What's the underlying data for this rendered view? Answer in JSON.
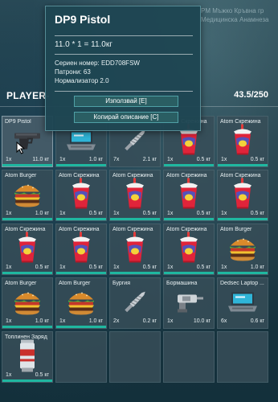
{
  "background": {
    "lines": [
      "PM   Мъжко   Кръвна гр",
      "",
      "",
      "",
      "Медицинска Анамнеза"
    ]
  },
  "inventory": {
    "title": "PLAYER-",
    "weight": "43.5/250"
  },
  "tooltip": {
    "title": "DP9 Pistol",
    "formula": "11.0 * 1 = 11.0кг",
    "props": [
      "Сериен номер: EDD708FSW",
      "Патрони: 63",
      "Нормализатор 2.0"
    ],
    "use_button": "Използвай [E]",
    "copy_button": "Копирай описание [C]"
  },
  "items": [
    {
      "name": "DP9 Pistol",
      "qty": "1x",
      "weight": "11.0 кг",
      "icon": "pistol-icon",
      "bar": true,
      "selected": true
    },
    {
      "name": "",
      "qty": "1x",
      "weight": "1.0 кг",
      "icon": "laptop-icon",
      "bar": true
    },
    {
      "name": "",
      "qty": "7x",
      "weight": "2.1 кг",
      "icon": "drill-bit-icon",
      "bar": false
    },
    {
      "name": "Atom Скрежина",
      "qty": "1x",
      "weight": "0.5 кг",
      "icon": "slush-cup-icon",
      "bar": true
    },
    {
      "name": "Atom Скрежина",
      "qty": "1x",
      "weight": "0.5 кг",
      "icon": "slush-cup-icon",
      "bar": true
    },
    {
      "name": "Atom Burger",
      "qty": "1x",
      "weight": "1.0 кг",
      "icon": "burger-icon",
      "bar": true
    },
    {
      "name": "Atom Скрежина",
      "qty": "1x",
      "weight": "0.5 кг",
      "icon": "slush-cup-icon",
      "bar": true
    },
    {
      "name": "Atom Скрежина",
      "qty": "1x",
      "weight": "0.5 кг",
      "icon": "slush-cup-icon",
      "bar": true
    },
    {
      "name": "Atom Скрежина",
      "qty": "1x",
      "weight": "0.5 кг",
      "icon": "slush-cup-icon",
      "bar": true
    },
    {
      "name": "Atom Скрежина",
      "qty": "1x",
      "weight": "0.5 кг",
      "icon": "slush-cup-icon",
      "bar": true
    },
    {
      "name": "Atom Скрежина",
      "qty": "1x",
      "weight": "0.5 кг",
      "icon": "slush-cup-icon",
      "bar": true
    },
    {
      "name": "Atom Скрежина",
      "qty": "1x",
      "weight": "0.5 кг",
      "icon": "slush-cup-icon",
      "bar": true
    },
    {
      "name": "Atom Скрежина",
      "qty": "1x",
      "weight": "0.5 кг",
      "icon": "slush-cup-icon",
      "bar": true
    },
    {
      "name": "Atom Скрежина",
      "qty": "1x",
      "weight": "0.5 кг",
      "icon": "slush-cup-icon",
      "bar": true
    },
    {
      "name": "Atom Burger",
      "qty": "1x",
      "weight": "1.0 кг",
      "icon": "burger-icon",
      "bar": true
    },
    {
      "name": "Atom Burger",
      "qty": "1x",
      "weight": "1.0 кг",
      "icon": "burger-icon",
      "bar": true
    },
    {
      "name": "Atom Burger",
      "qty": "1x",
      "weight": "1.0 кг",
      "icon": "burger-icon",
      "bar": true
    },
    {
      "name": "Бургия",
      "qty": "2x",
      "weight": "0.2 кг",
      "icon": "drill-bit-icon",
      "bar": false
    },
    {
      "name": "Бормашина",
      "qty": "1x",
      "weight": "10.0 кг",
      "icon": "drill-icon",
      "bar": false
    },
    {
      "name": "Dedsec Laptop ...",
      "qty": "6x",
      "weight": "0.6 кг",
      "icon": "laptop-icon",
      "bar": false
    },
    {
      "name": "Топлинен Заряд",
      "qty": "1x",
      "weight": "0.5 кг",
      "icon": "thermite-icon",
      "bar": true
    },
    {
      "name": "",
      "qty": "",
      "weight": "",
      "icon": "",
      "bar": false
    },
    {
      "name": "",
      "qty": "",
      "weight": "",
      "icon": "",
      "bar": false
    },
    {
      "name": "",
      "qty": "",
      "weight": "",
      "icon": "",
      "bar": false
    },
    {
      "name": "",
      "qty": "",
      "weight": "",
      "icon": "",
      "bar": false
    }
  ]
}
